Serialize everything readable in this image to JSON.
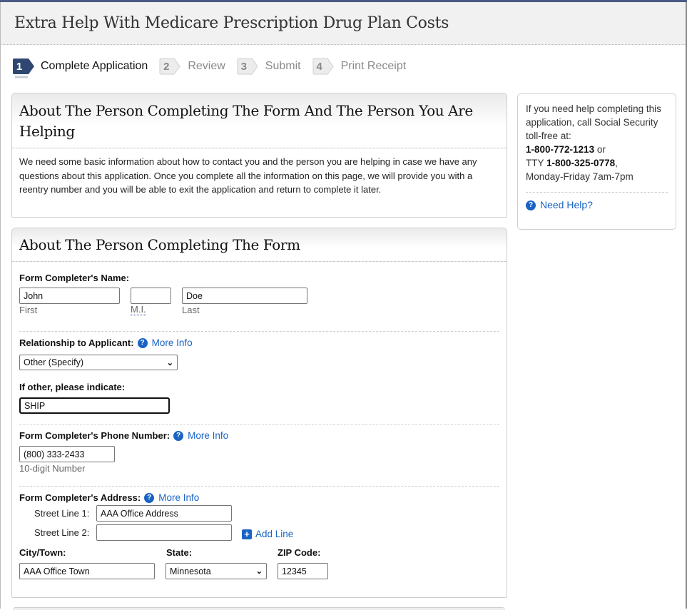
{
  "header": {
    "title": "Extra Help With Medicare Prescription Drug Plan Costs"
  },
  "steps": [
    {
      "number": "1",
      "label": "Complete Application",
      "state": "active"
    },
    {
      "number": "2",
      "label": "Review",
      "state": "inactive"
    },
    {
      "number": "3",
      "label": "Submit",
      "state": "inactive"
    },
    {
      "number": "4",
      "label": "Print Receipt",
      "state": "inactive"
    }
  ],
  "intro": {
    "title": "About The Person Completing The Form And The Person You Are Helping",
    "text": "We need some basic information about how to contact you and the person you are helping in case we have any questions about this application. Once you complete all the information on this page, we will provide you with a reentry number and you will be able to exit the application and return to complete it later."
  },
  "help": {
    "text1": "If you need help completing this application, call Social Security toll-free at:",
    "phone": "1-800-772-1213",
    "or": " or",
    "tty_prefix": "TTY ",
    "tty_phone": "1-800-325-0778",
    "tty_suffix": ",",
    "hours": "Monday-Friday 7am-7pm",
    "link": "Need Help?"
  },
  "form": {
    "title": "About The Person Completing The Form",
    "name": {
      "label": "Form Completer's Name:",
      "first_value": "John",
      "first_label": "First",
      "mi_value": "",
      "mi_label": "M.I.",
      "last_value": "Doe",
      "last_label": "Last"
    },
    "relationship": {
      "label": "Relationship to Applicant:",
      "more_info": "More Info",
      "selected": "Other (Specify)"
    },
    "other": {
      "label": "If other, please indicate:",
      "value": "SHIP"
    },
    "phone": {
      "label": "Form Completer's Phone Number:",
      "more_info": "More Info",
      "value": "(800) 333-2433",
      "hint": "10-digit Number"
    },
    "address": {
      "label": "Form Completer's Address:",
      "more_info": "More Info",
      "street1_label": "Street Line 1:",
      "street1_value": "AAA Office Address",
      "street2_label": "Street Line 2:",
      "street2_value": "",
      "add_line": "Add Line",
      "city_label": "City/Town:",
      "city_value": "AAA Office Town",
      "state_label": "State:",
      "state_selected": "Minnesota",
      "zip_label": "ZIP Code:",
      "zip_value": "12345"
    }
  },
  "colors": {
    "accent": "#1a63c5",
    "topbar": "#4a5a86",
    "step_active": "#2f4770"
  }
}
